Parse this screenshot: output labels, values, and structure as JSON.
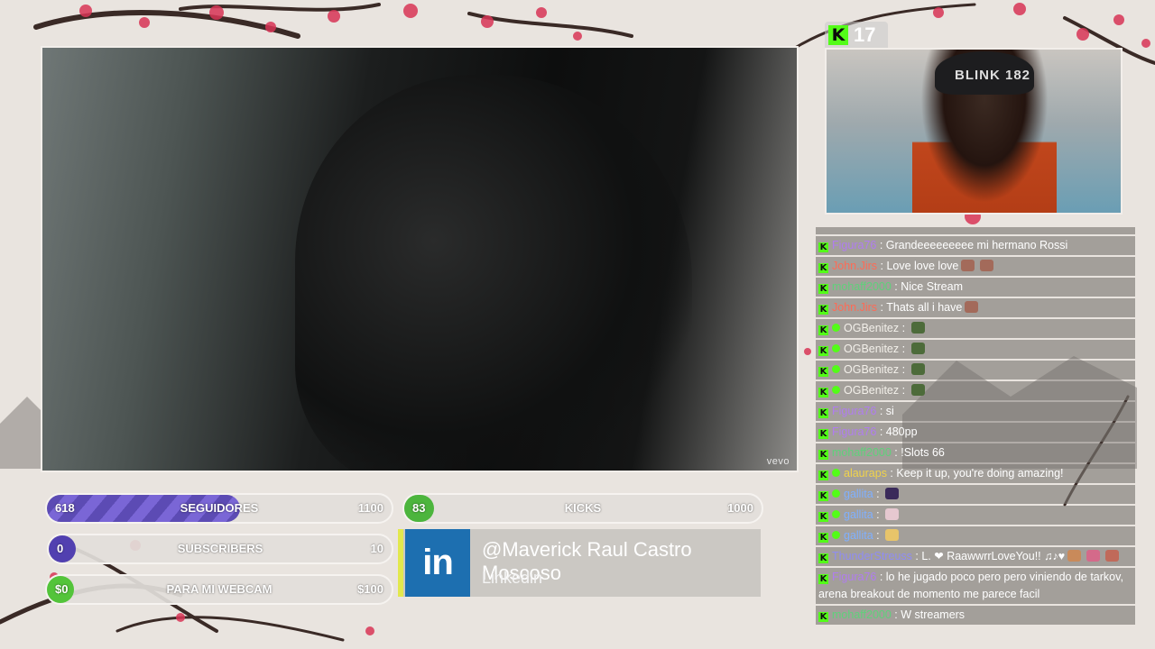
{
  "viewers": {
    "icon": "kick-icon",
    "count": "17"
  },
  "video": {
    "watermark": "vevo"
  },
  "webcam": {
    "hat_text": "BLINK 182"
  },
  "goals": {
    "followers": {
      "label": "SEGUIDORES",
      "current": "618",
      "max": "1100",
      "progress": 0.56,
      "color": "#6a57c8"
    },
    "subscribers": {
      "label": "SUBSCRIBERS",
      "current": "0",
      "max": "10",
      "progress": 0.0,
      "color": "#5140b0"
    },
    "webcam": {
      "label": "PARA MI WEBCAM",
      "current": "$0",
      "max": "$100",
      "progress": 0.0,
      "color": "#53c43a"
    },
    "kicks": {
      "label": "KICKS",
      "current": "83",
      "max": "1000",
      "progress": 0.083,
      "color": "#4cb53d"
    }
  },
  "social": {
    "icon": "linkedin-icon",
    "logo_text": "in",
    "handle": "@Maverick Raul Castro Moscoso",
    "platform": "Linkedin"
  },
  "chat": {
    "messages": [
      {
        "user": "Figura76",
        "color": "#b07cf0",
        "verified": false,
        "text": "Grandeeeeeeeee mi hermano Rossi",
        "emotes": []
      },
      {
        "user": "John.Jirs",
        "color": "#ff6a55",
        "verified": false,
        "text": "Love love love",
        "emotes": [
          "#a36a5a",
          "#a36a5a"
        ]
      },
      {
        "user": "mohaff2000",
        "color": "#5ed27a",
        "verified": false,
        "text": "Nice Stream",
        "emotes": []
      },
      {
        "user": "John.Jirs",
        "color": "#ff6a55",
        "verified": false,
        "text": "Thats all i have",
        "emotes": [
          "#a36a5a"
        ]
      },
      {
        "user": "OGBenitez",
        "color": "#f3f0ea",
        "verified": true,
        "text": "",
        "emotes": [
          "#4d6b3a"
        ]
      },
      {
        "user": "OGBenitez",
        "color": "#f3f0ea",
        "verified": true,
        "text": "",
        "emotes": [
          "#4d6b3a"
        ]
      },
      {
        "user": "OGBenitez",
        "color": "#f3f0ea",
        "verified": true,
        "text": "",
        "emotes": [
          "#4d6b3a"
        ]
      },
      {
        "user": "OGBenitez",
        "color": "#f3f0ea",
        "verified": true,
        "text": "",
        "emotes": [
          "#4d6b3a"
        ]
      },
      {
        "user": "Figura76",
        "color": "#b07cf0",
        "verified": false,
        "text": "si",
        "emotes": []
      },
      {
        "user": "Figura76",
        "color": "#b07cf0",
        "verified": false,
        "text": "480pp",
        "emotes": []
      },
      {
        "user": "mohaff2000",
        "color": "#5ed27a",
        "verified": false,
        "text": "!Slots 66",
        "emotes": []
      },
      {
        "user": "alauraps",
        "color": "#f0d34a",
        "verified": true,
        "text": "Keep it up, you're doing amazing!",
        "emotes": []
      },
      {
        "user": "gallita",
        "color": "#7fb0ff",
        "verified": true,
        "text": "",
        "emotes": [
          "#3a2a5a"
        ]
      },
      {
        "user": "gallita",
        "color": "#7fb0ff",
        "verified": true,
        "text": "",
        "emotes": [
          "#e6c8d0"
        ]
      },
      {
        "user": "gallita",
        "color": "#7fb0ff",
        "verified": true,
        "text": "",
        "emotes": [
          "#e8c46a"
        ]
      },
      {
        "user": "ThunderStreuss",
        "color": "#8f8cf5",
        "verified": false,
        "text": "L. ❤ RaawwrrLoveYou!! ♫♪♥",
        "emotes": [
          "#c98a5a",
          "#d46a8a",
          "#c06a5a"
        ]
      },
      {
        "user": "Figura76",
        "color": "#b07cf0",
        "verified": false,
        "text": "lo he jugado poco pero pero viniendo de tarkov, arena breakout de momento me parece facil",
        "emotes": []
      },
      {
        "user": "mohaff2000",
        "color": "#5ed27a",
        "verified": false,
        "text": "W streamers",
        "emotes": []
      }
    ]
  }
}
